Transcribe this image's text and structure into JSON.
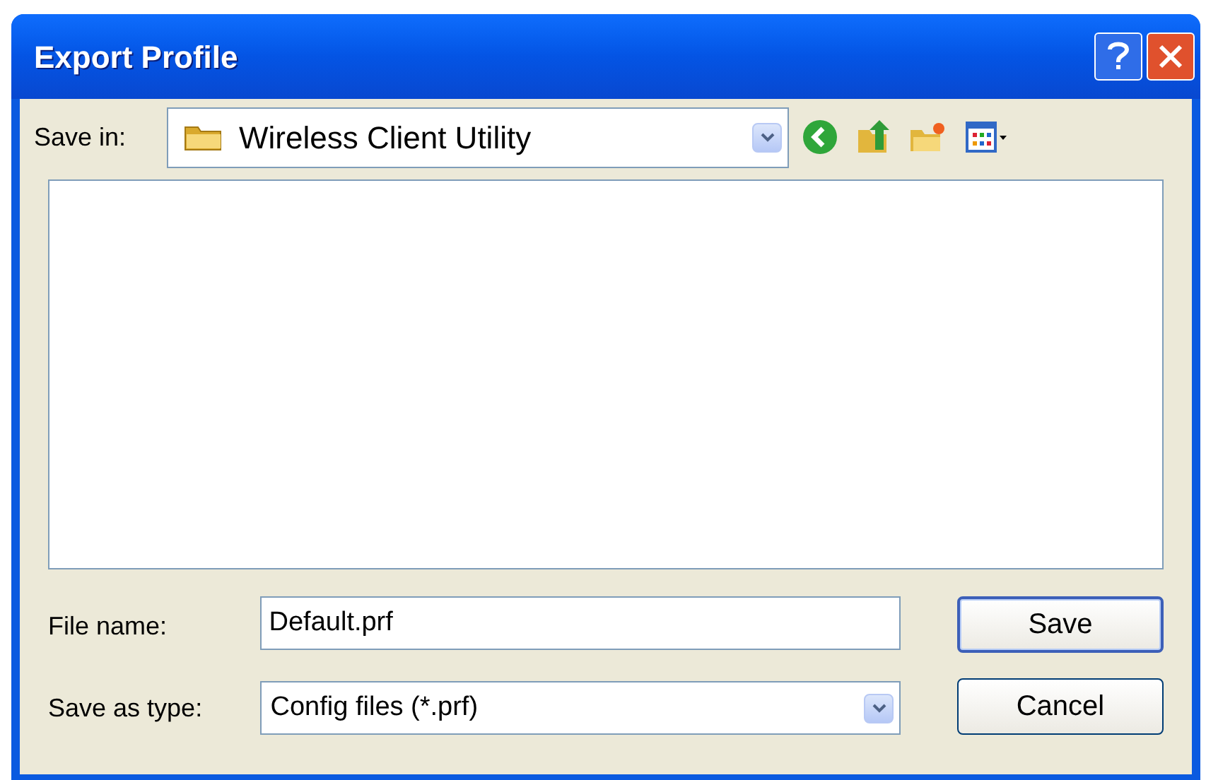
{
  "window": {
    "title": "Export Profile"
  },
  "save_in": {
    "label": "Save in:",
    "value": "Wireless Client Utility"
  },
  "file_name": {
    "label": "File name:",
    "value": "Default.prf"
  },
  "save_as_type": {
    "label": "Save as type:",
    "value": "Config files (*.prf)"
  },
  "buttons": [
    {
      "label": "Save",
      "default": true
    },
    {
      "label": "Cancel",
      "default": false
    }
  ]
}
